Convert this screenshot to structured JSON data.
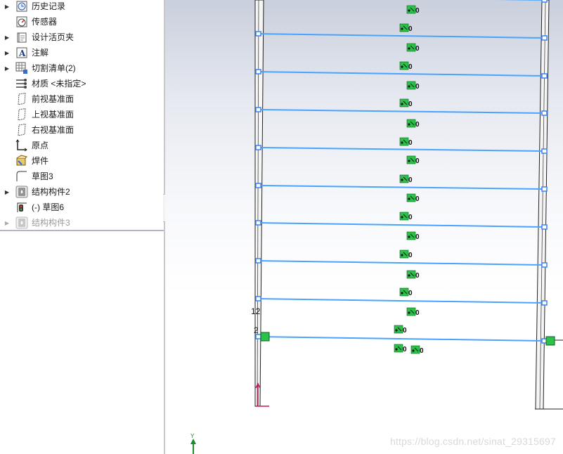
{
  "feature_tree": {
    "items": [
      {
        "label": "历史记录",
        "icon": "history-icon",
        "expandable": true
      },
      {
        "label": "传感器",
        "icon": "sensor-icon",
        "expandable": false
      },
      {
        "label": "设计活页夹",
        "icon": "design-binder-icon",
        "expandable": true
      },
      {
        "label": "注解",
        "icon": "annotation-icon",
        "expandable": true
      },
      {
        "label": "切割清单(2)",
        "icon": "cut-list-icon",
        "expandable": true
      },
      {
        "label": "材质 <未指定>",
        "icon": "material-icon",
        "expandable": false
      },
      {
        "label": "前视基准面",
        "icon": "plane-icon",
        "expandable": false
      },
      {
        "label": "上视基准面",
        "icon": "plane-icon",
        "expandable": false
      },
      {
        "label": "右视基准面",
        "icon": "plane-icon",
        "expandable": false
      },
      {
        "label": "原点",
        "icon": "origin-icon",
        "expandable": false
      },
      {
        "label": "焊件",
        "icon": "weldment-icon",
        "expandable": false
      },
      {
        "label": "草图3",
        "icon": "sketch-icon",
        "expandable": false
      },
      {
        "label": "结构构件2",
        "icon": "structural-member-icon",
        "expandable": true
      },
      {
        "label": "(-) 草图6",
        "icon": "sketch-edit-icon",
        "expandable": false
      },
      {
        "label": "结构构件3",
        "icon": "structural-member-icon",
        "expandable": true,
        "disabled": true
      }
    ]
  },
  "viewport": {
    "relation_labels": [
      "0",
      "0",
      "0",
      "0",
      "0",
      "0",
      "0",
      "0",
      "0",
      "0",
      "0",
      "0",
      "0",
      "0",
      "0",
      "0",
      "0",
      "0",
      "0",
      "0"
    ],
    "dimension_labels": [
      "12",
      "2"
    ],
    "axis_label": "Y",
    "watermark": "https://blog.csdn.net/sinat_29315697",
    "colors": {
      "sketch_line": "#4aa3ff",
      "relation_badge": "#2cc24a",
      "sketch_point": "#3b82f6"
    }
  }
}
